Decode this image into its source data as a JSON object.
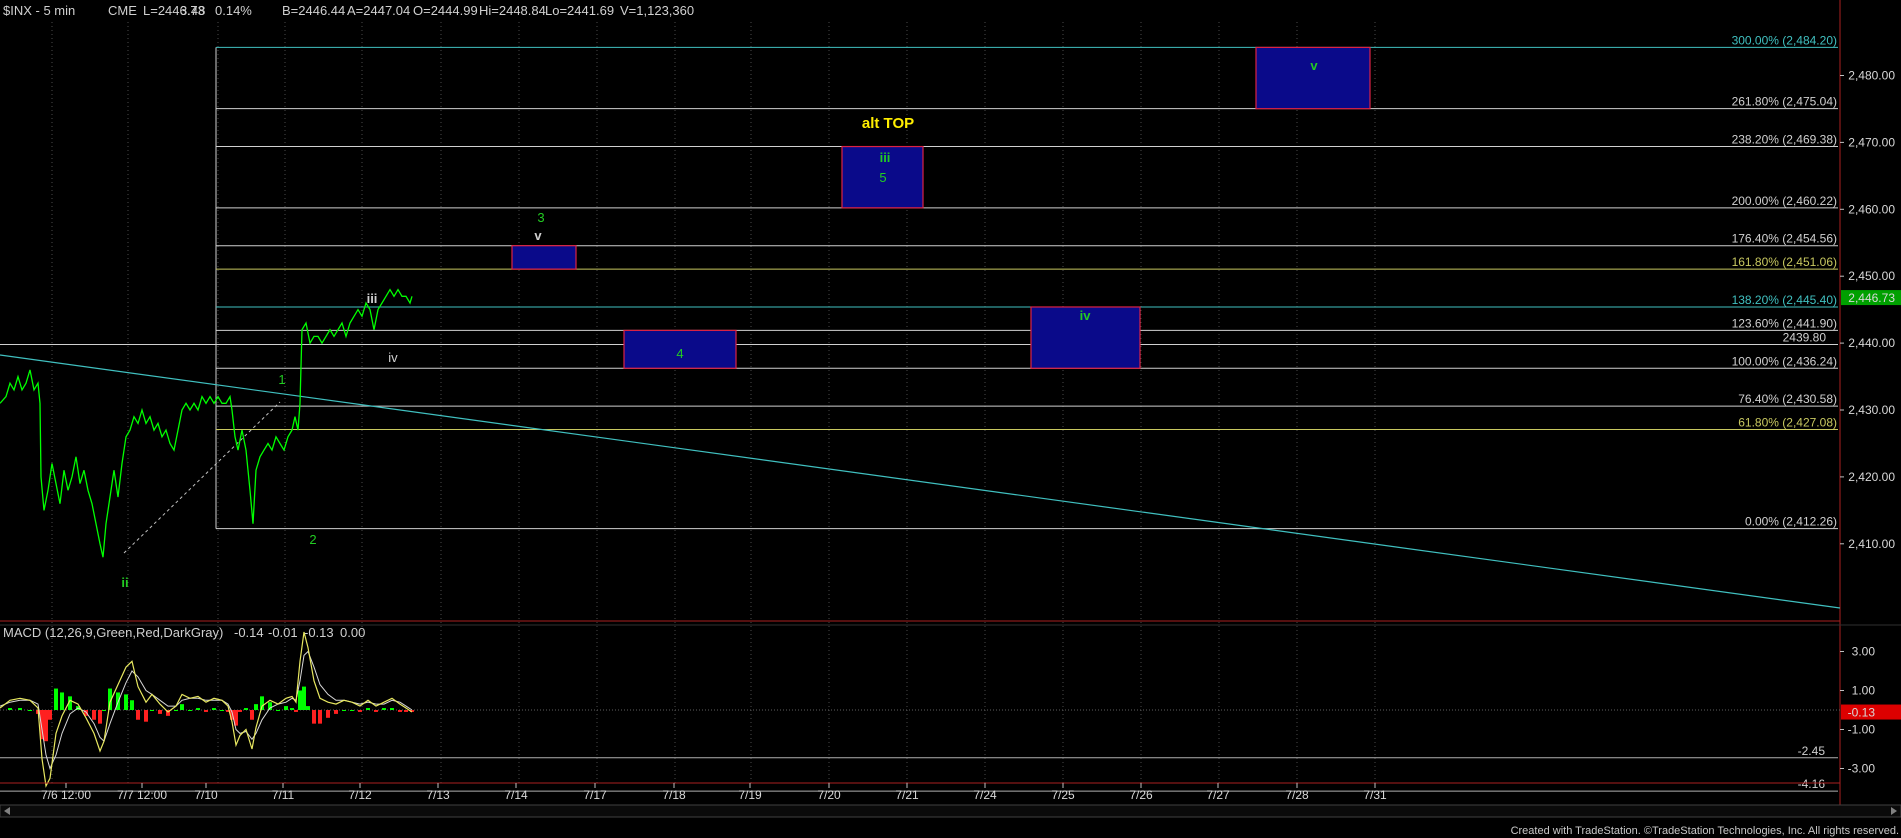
{
  "header": {
    "symbol": "$INX - 5 min",
    "quotes": [
      "CME",
      "L=2446.73",
      "3.48",
      "0.14%",
      "B=2446.44",
      "A=2447.04",
      "O=2444.99",
      "Hi=2448.84",
      "Lo=2441.69",
      "V=1,123,360"
    ]
  },
  "macd_header": {
    "label": "MACD (12,26,9,Green,Red,DarkGray)",
    "values": [
      {
        "text": "-0.14",
        "color": "#ffff66"
      },
      {
        "text": "-0.01",
        "color": "#8fd0ff"
      },
      {
        "text": "-0.13",
        "color": "#ff3030"
      },
      {
        "text": "0.00",
        "color": "#22aa22"
      }
    ]
  },
  "footer": "Created with TradeStation. ©TradeStation Technologies, Inc. All rights reserved.",
  "colors": {
    "background": "#000000",
    "price": "#00ff00",
    "trendline": "#40c0c0",
    "fib_line": "#d0d0d0",
    "fib_gold": "#c8c860",
    "box_fill": "#0a0a8a",
    "box_border": "#dd2244",
    "wave_green": "#22cc22",
    "wave_white": "#d0d0d0",
    "alt_top": "#ffee00",
    "macd_line": "#e8e860",
    "signal_line": "#d8d8d8",
    "hist_pos": "#00ff00",
    "hist_neg": "#ff2020",
    "last_price_bg": "#00a000",
    "macd_last_bg": "#dd0000"
  },
  "chart_data": {
    "type": "line",
    "price_axis": {
      "range": [
        2402,
        2490
      ],
      "ticks": [
        "2,480.00",
        "2,470.00",
        "2,460.00",
        "2,450.00",
        "2,440.00",
        "2,430.00",
        "2,420.00",
        "2,410.00"
      ],
      "tick_values": [
        2480,
        2470,
        2460,
        2450,
        2440,
        2430,
        2420,
        2410
      ],
      "last_price": "2,446.73",
      "last_price_value": 2446.73
    },
    "x_ticks": [
      "7/6 12:00",
      "7/7 12:00",
      "7/10",
      "7/11",
      "7/12",
      "7/13",
      "7/14",
      "7/17",
      "7/18",
      "7/19",
      "7/20",
      "7/21",
      "7/24",
      "7/25",
      "7/26",
      "7/27",
      "7/28",
      "7/31"
    ],
    "fib_levels": [
      {
        "label": "300.00% (2,484.20)",
        "value": 2484.2,
        "color": "#40c0c0"
      },
      {
        "label": "261.80% (2,475.04)",
        "value": 2475.04,
        "color": "#d0d0d0"
      },
      {
        "label": "238.20% (2,469.38)",
        "value": 2469.38,
        "color": "#d0d0d0"
      },
      {
        "label": "200.00% (2,460.22)",
        "value": 2460.22,
        "color": "#d0d0d0"
      },
      {
        "label": "176.40% (2,454.56)",
        "value": 2454.56,
        "color": "#d0d0d0"
      },
      {
        "label": "161.80% (2,451.06)",
        "value": 2451.06,
        "color": "#c8c860"
      },
      {
        "label": "138.20% (2,445.40)",
        "value": 2445.4,
        "color": "#40c0c0"
      },
      {
        "label": "123.60% (2,441.90)",
        "value": 2441.9,
        "color": "#d0d0d0"
      },
      {
        "label": "100.00% (2,436.24)",
        "value": 2436.24,
        "color": "#d0d0d0"
      },
      {
        "label": "76.40% (2,430.58)",
        "value": 2430.58,
        "color": "#d0d0d0"
      },
      {
        "label": "61.80% (2,427.08)",
        "value": 2427.08,
        "color": "#c8c860"
      },
      {
        "label": "0.00% (2,412.26)",
        "value": 2412.26,
        "color": "#d0d0d0"
      }
    ],
    "horizontal_line": {
      "label": "2439.80",
      "value": 2439.8
    },
    "target_boxes": [
      {
        "label": "v",
        "x_from": "7/13 15:00",
        "x_to": "7/14 10:00",
        "y_from": 2451.06,
        "y_to": 2454.56
      },
      {
        "label": "4",
        "x_from": "7/17 12:00",
        "x_to": "7/18 14:00",
        "y_from": 2436.24,
        "y_to": 2441.9
      },
      {
        "label": "iii",
        "x_from": "7/20 12:00",
        "x_to": "7/21 12:00",
        "y_from": 2460.22,
        "y_to": 2469.38
      },
      {
        "label": "iv",
        "x_from": "7/24 12:00",
        "x_to": "7/25 14:00",
        "y_from": 2436.24,
        "y_to": 2445.4
      },
      {
        "label": "v",
        "x_from": "7/27 12:00",
        "x_to": "7/28 14:00",
        "y_from": 2475.04,
        "y_to": 2484.2
      }
    ],
    "wave_labels": [
      {
        "text": "ii",
        "color": "#22cc22"
      },
      {
        "text": "1",
        "color": "#22cc22"
      },
      {
        "text": "2",
        "color": "#22cc22"
      },
      {
        "text": "iii",
        "color": "#d0d0d0"
      },
      {
        "text": "iv",
        "color": "#d0d0d0"
      },
      {
        "text": "3",
        "color": "#22cc22"
      },
      {
        "text": "v",
        "color": "#d0d0d0"
      },
      {
        "text": "4",
        "color": "#22cc22"
      },
      {
        "text": "iii",
        "color": "#22cc22"
      },
      {
        "text": "5",
        "color": "#22cc22"
      },
      {
        "text": "iv",
        "color": "#22cc22"
      },
      {
        "text": "v",
        "color": "#22cc22"
      }
    ],
    "annotation": "alt TOP",
    "series": [
      {
        "name": "$INX",
        "points": [
          [
            0,
            2431
          ],
          [
            6,
            2432
          ],
          [
            10,
            2434
          ],
          [
            14,
            2433
          ],
          [
            18,
            2435
          ],
          [
            22,
            2433
          ],
          [
            26,
            2434
          ],
          [
            30,
            2436
          ],
          [
            34,
            2433
          ],
          [
            38,
            2434
          ],
          [
            40,
            2431
          ],
          [
            41,
            2420
          ],
          [
            44,
            2415
          ],
          [
            48,
            2418
          ],
          [
            52,
            2422
          ],
          [
            56,
            2419
          ],
          [
            60,
            2416
          ],
          [
            64,
            2421
          ],
          [
            68,
            2418
          ],
          [
            72,
            2420
          ],
          [
            76,
            2423
          ],
          [
            80,
            2419
          ],
          [
            84,
            2421
          ],
          [
            88,
            2418
          ],
          [
            92,
            2416
          ],
          [
            96,
            2413
          ],
          [
            100,
            2410
          ],
          [
            103,
            2408
          ],
          [
            106,
            2413
          ],
          [
            110,
            2417
          ],
          [
            114,
            2421
          ],
          [
            118,
            2417
          ],
          [
            122,
            2422
          ],
          [
            126,
            2426
          ],
          [
            130,
            2427
          ],
          [
            134,
            2429
          ],
          [
            138,
            2428
          ],
          [
            142,
            2430
          ],
          [
            146,
            2428
          ],
          [
            150,
            2429
          ],
          [
            154,
            2427
          ],
          [
            158,
            2428
          ],
          [
            162,
            2426
          ],
          [
            166,
            2427
          ],
          [
            170,
            2425
          ],
          [
            174,
            2424
          ],
          [
            178,
            2427
          ],
          [
            182,
            2430
          ],
          [
            186,
            2431
          ],
          [
            190,
            2430
          ],
          [
            194,
            2431
          ],
          [
            198,
            2430
          ],
          [
            202,
            2432
          ],
          [
            206,
            2431
          ],
          [
            210,
            2432
          ],
          [
            214,
            2431
          ],
          [
            218,
            2432
          ],
          [
            222,
            2431
          ],
          [
            226,
            2431
          ],
          [
            230,
            2432
          ],
          [
            232,
            2430
          ],
          [
            235,
            2426
          ],
          [
            238,
            2424
          ],
          [
            242,
            2427
          ],
          [
            246,
            2424
          ],
          [
            250,
            2418
          ],
          [
            253,
            2413
          ],
          [
            256,
            2421
          ],
          [
            260,
            2423
          ],
          [
            264,
            2424
          ],
          [
            268,
            2425
          ],
          [
            272,
            2424
          ],
          [
            276,
            2426
          ],
          [
            280,
            2425
          ],
          [
            284,
            2424
          ],
          [
            288,
            2426
          ],
          [
            292,
            2427
          ],
          [
            295,
            2429
          ],
          [
            298,
            2427
          ],
          [
            300,
            2431
          ],
          [
            302,
            2442
          ],
          [
            306,
            2443
          ],
          [
            310,
            2440
          ],
          [
            314,
            2441
          ],
          [
            318,
            2441
          ],
          [
            322,
            2440
          ],
          [
            326,
            2441
          ],
          [
            330,
            2442
          ],
          [
            334,
            2441
          ],
          [
            338,
            2442
          ],
          [
            342,
            2443
          ],
          [
            346,
            2441
          ],
          [
            350,
            2443
          ],
          [
            354,
            2444
          ],
          [
            358,
            2445
          ],
          [
            362,
            2444
          ],
          [
            366,
            2446
          ],
          [
            370,
            2445
          ],
          [
            374,
            2442
          ],
          [
            378,
            2445
          ],
          [
            382,
            2446
          ],
          [
            386,
            2447
          ],
          [
            390,
            2448
          ],
          [
            394,
            2447
          ],
          [
            398,
            2448
          ],
          [
            402,
            2447
          ],
          [
            406,
            2447
          ],
          [
            410,
            2446
          ],
          [
            412,
            2447
          ]
        ]
      }
    ],
    "macd_panel": {
      "ticks": [
        "3.00",
        "1.00",
        "-1.00",
        "-3.00"
      ],
      "tick_values": [
        3,
        1,
        -1,
        -3
      ],
      "range": [
        -4.6,
        4.2
      ],
      "levels": [
        {
          "label": "-2.45",
          "value": -2.45
        },
        {
          "label": "-4.16",
          "value": -4.16
        }
      ],
      "last_value": "-0.13",
      "macd": [
        [
          0,
          0.1
        ],
        [
          10,
          0.5
        ],
        [
          20,
          0.6
        ],
        [
          30,
          0.5
        ],
        [
          38,
          0.1
        ],
        [
          42,
          -2.5
        ],
        [
          46,
          -3.9
        ],
        [
          50,
          -3.5
        ],
        [
          56,
          -1.2
        ],
        [
          62,
          -0.3
        ],
        [
          70,
          0.5
        ],
        [
          78,
          0.3
        ],
        [
          86,
          -0.4
        ],
        [
          94,
          -1.2
        ],
        [
          100,
          -2.1
        ],
        [
          104,
          -1.6
        ],
        [
          110,
          0.4
        ],
        [
          118,
          1.3
        ],
        [
          126,
          2.2
        ],
        [
          132,
          2.5
        ],
        [
          138,
          1.2
        ],
        [
          146,
          0.4
        ],
        [
          152,
          0.8
        ],
        [
          160,
          0.3
        ],
        [
          168,
          -0.1
        ],
        [
          176,
          0.2
        ],
        [
          182,
          0.8
        ],
        [
          190,
          0.6
        ],
        [
          198,
          0.7
        ],
        [
          206,
          0.4
        ],
        [
          214,
          0.6
        ],
        [
          222,
          0.5
        ],
        [
          228,
          0.2
        ],
        [
          232,
          -0.6
        ],
        [
          236,
          -1.8
        ],
        [
          240,
          -1.3
        ],
        [
          246,
          -1.0
        ],
        [
          252,
          -2.0
        ],
        [
          256,
          -0.9
        ],
        [
          262,
          0.2
        ],
        [
          270,
          0.5
        ],
        [
          278,
          0.3
        ],
        [
          286,
          0.6
        ],
        [
          292,
          0.7
        ],
        [
          296,
          0.4
        ],
        [
          300,
          2.5
        ],
        [
          304,
          4.0
        ],
        [
          308,
          3.2
        ],
        [
          314,
          1.5
        ],
        [
          320,
          0.6
        ],
        [
          328,
          0.4
        ],
        [
          336,
          0.3
        ],
        [
          344,
          0.5
        ],
        [
          352,
          0.4
        ],
        [
          360,
          0.2
        ],
        [
          368,
          0.5
        ],
        [
          376,
          0.2
        ],
        [
          384,
          0.4
        ],
        [
          392,
          0.6
        ],
        [
          400,
          0.3
        ],
        [
          406,
          0.1
        ],
        [
          412,
          -0.1
        ]
      ],
      "signal": [
        [
          0,
          0.2
        ],
        [
          10,
          0.4
        ],
        [
          20,
          0.5
        ],
        [
          30,
          0.5
        ],
        [
          38,
          0.3
        ],
        [
          42,
          -1.0
        ],
        [
          46,
          -2.3
        ],
        [
          50,
          -3.0
        ],
        [
          56,
          -2.3
        ],
        [
          62,
          -1.2
        ],
        [
          70,
          -0.2
        ],
        [
          78,
          0.1
        ],
        [
          86,
          -0.1
        ],
        [
          94,
          -0.7
        ],
        [
          100,
          -1.4
        ],
        [
          104,
          -1.6
        ],
        [
          110,
          -0.7
        ],
        [
          118,
          0.4
        ],
        [
          126,
          1.4
        ],
        [
          132,
          2.0
        ],
        [
          138,
          1.7
        ],
        [
          146,
          1.0
        ],
        [
          152,
          0.8
        ],
        [
          160,
          0.5
        ],
        [
          168,
          0.2
        ],
        [
          176,
          0.2
        ],
        [
          182,
          0.5
        ],
        [
          190,
          0.6
        ],
        [
          198,
          0.6
        ],
        [
          206,
          0.5
        ],
        [
          214,
          0.5
        ],
        [
          222,
          0.5
        ],
        [
          228,
          0.3
        ],
        [
          232,
          -0.1
        ],
        [
          236,
          -1.0
        ],
        [
          240,
          -1.2
        ],
        [
          246,
          -1.1
        ],
        [
          252,
          -1.5
        ],
        [
          256,
          -1.2
        ],
        [
          262,
          -0.5
        ],
        [
          270,
          0.1
        ],
        [
          278,
          0.3
        ],
        [
          286,
          0.4
        ],
        [
          292,
          0.6
        ],
        [
          296,
          0.5
        ],
        [
          300,
          1.5
        ],
        [
          304,
          2.8
        ],
        [
          308,
          3.0
        ],
        [
          314,
          2.2
        ],
        [
          320,
          1.3
        ],
        [
          328,
          0.8
        ],
        [
          336,
          0.5
        ],
        [
          344,
          0.5
        ],
        [
          352,
          0.4
        ],
        [
          360,
          0.3
        ],
        [
          368,
          0.4
        ],
        [
          376,
          0.3
        ],
        [
          384,
          0.3
        ],
        [
          392,
          0.5
        ],
        [
          400,
          0.4
        ],
        [
          406,
          0.2
        ],
        [
          412,
          0.0
        ]
      ]
    }
  }
}
